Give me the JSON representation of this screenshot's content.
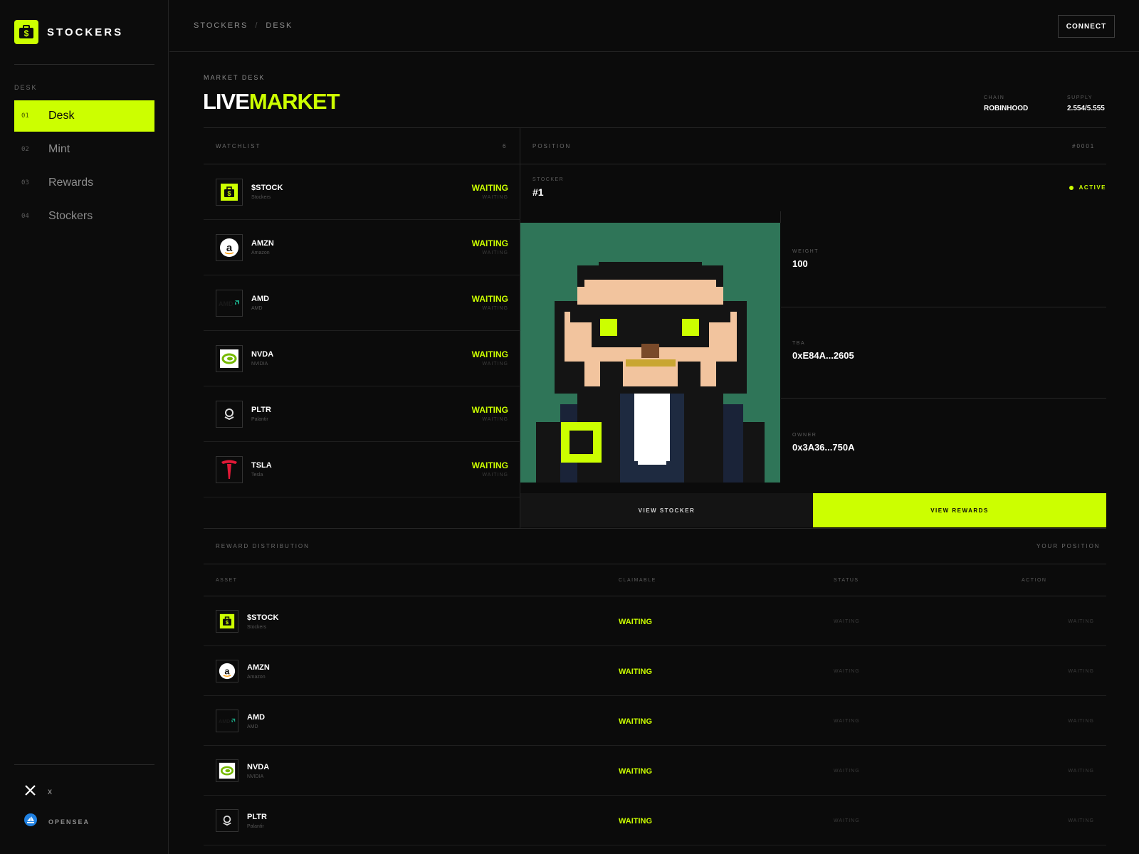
{
  "brand": {
    "name": "STOCKERS",
    "accent": "#ccff00"
  },
  "sidebar": {
    "section": "DESK",
    "items": [
      {
        "num": "01",
        "label": "Desk",
        "active": true
      },
      {
        "num": "02",
        "label": "Mint"
      },
      {
        "num": "03",
        "label": "Rewards"
      },
      {
        "num": "04",
        "label": "Stockers"
      }
    ],
    "social": [
      {
        "label": "X",
        "icon": "x-icon"
      },
      {
        "label": "OPENSEA",
        "icon": "opensea-icon"
      }
    ]
  },
  "header": {
    "breadcrumb": [
      "STOCKERS",
      "/",
      "DESK"
    ],
    "connect_label": "CONNECT"
  },
  "main": {
    "eyebrow": "MARKET DESK",
    "title_a": "LIVE",
    "title_b": "MARKET",
    "meta": [
      {
        "key": "CHAIN",
        "value": "ROBINHOOD"
      },
      {
        "key": "SUPPLY",
        "value": "2.554/5.555"
      }
    ]
  },
  "watchlist": {
    "title": "WATCHLIST",
    "count": "6",
    "items": [
      {
        "ticker": "$STOCK",
        "name": "Stockers",
        "status": "WAITING",
        "sub": "WAITING",
        "icon": "stockers-logo-icon"
      },
      {
        "ticker": "AMZN",
        "name": "Amazon",
        "status": "WAITING",
        "sub": "WAITING",
        "icon": "amazon-logo-icon"
      },
      {
        "ticker": "AMD",
        "name": "AMD",
        "status": "WAITING",
        "sub": "WAITING",
        "icon": "amd-logo-icon"
      },
      {
        "ticker": "NVDA",
        "name": "NVIDIA",
        "status": "WAITING",
        "sub": "WAITING",
        "icon": "nvidia-logo-icon"
      },
      {
        "ticker": "PLTR",
        "name": "Palantir",
        "status": "WAITING",
        "sub": "WAITING",
        "icon": "palantir-logo-icon"
      },
      {
        "ticker": "TSLA",
        "name": "Tesla",
        "status": "WAITING",
        "sub": "WAITING",
        "icon": "tesla-logo-icon"
      }
    ]
  },
  "position": {
    "title": "POSITION",
    "id": "#0001",
    "stocker_label": "STOCKER",
    "stocker_value": "#1",
    "status": "ACTIVE",
    "stats": [
      {
        "key": "WEIGHT",
        "value": "100"
      },
      {
        "key": "TBA",
        "value": "0xE84A...2605"
      },
      {
        "key": "OWNER",
        "value": "0x3A36...750A"
      }
    ],
    "view_stocker": "VIEW STOCKER",
    "view_rewards": "VIEW REWARDS"
  },
  "rewards": {
    "title": "REWARD DISTRIBUTION",
    "right_label": "YOUR POSITION",
    "columns": [
      "ASSET",
      "CLAIMABLE",
      "STATUS",
      "ACTION"
    ],
    "rows": [
      {
        "ticker": "$STOCK",
        "name": "Stockers",
        "claimable": "WAITING",
        "status": "WAITING",
        "action": "WAITING",
        "icon": "stockers-logo-icon"
      },
      {
        "ticker": "AMZN",
        "name": "Amazon",
        "claimable": "WAITING",
        "status": "WAITING",
        "action": "WAITING",
        "icon": "amazon-logo-icon"
      },
      {
        "ticker": "AMD",
        "name": "AMD",
        "claimable": "WAITING",
        "status": "WAITING",
        "action": "WAITING",
        "icon": "amd-logo-icon"
      },
      {
        "ticker": "NVDA",
        "name": "NVIDIA",
        "claimable": "WAITING",
        "status": "WAITING",
        "action": "WAITING",
        "icon": "nvidia-logo-icon"
      },
      {
        "ticker": "PLTR",
        "name": "Palantir",
        "claimable": "WAITING",
        "status": "WAITING",
        "action": "WAITING",
        "icon": "palantir-logo-icon"
      }
    ]
  }
}
